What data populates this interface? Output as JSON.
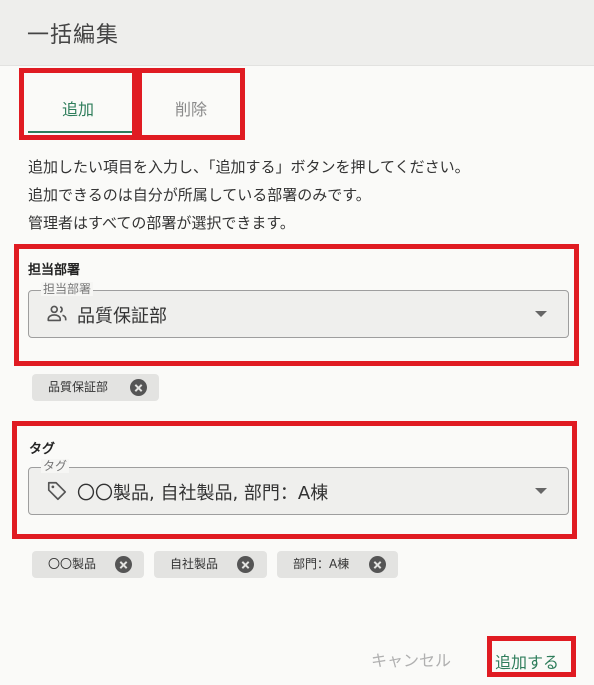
{
  "dialog": {
    "title": "一括編集"
  },
  "tabs": [
    {
      "label": "追加",
      "active": true
    },
    {
      "label": "削除",
      "active": false
    }
  ],
  "instructions": [
    "追加したい項目を入力し、「追加する」ボタンを押してください。",
    "追加できるのは自分が所属している部署のみです。",
    "管理者はすべての部署が選択できます。"
  ],
  "department": {
    "heading": "担当部署",
    "field_label": "担当部署",
    "value": "品質保証部",
    "icon": "people-icon",
    "chips": [
      "品質保証部"
    ]
  },
  "tag": {
    "heading": "タグ",
    "field_label": "タグ",
    "value": "〇〇製品, 自社製品, 部門：A棟",
    "icon": "tag-icon",
    "chips": [
      "〇〇製品",
      "自社製品",
      "部門：A棟"
    ]
  },
  "footer": {
    "cancel_label": "キャンセル",
    "submit_label": "追加する"
  },
  "colors": {
    "accent": "#2e7d5b",
    "highlight": "#e01b22",
    "chip_bg": "#e3e3e1"
  }
}
